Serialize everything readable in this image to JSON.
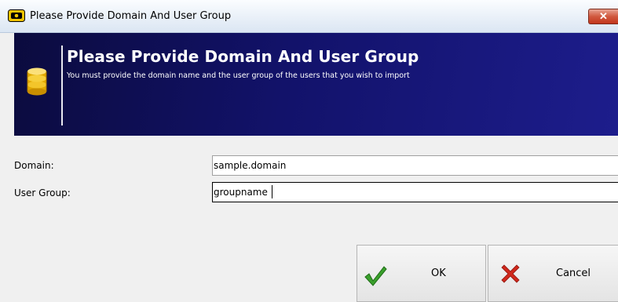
{
  "window": {
    "title": "Please Provide Domain And User Group",
    "close_glyph": "✕"
  },
  "banner": {
    "title": "Please Provide Domain And User Group",
    "subtitle": "You must provide the domain name and the user group of the users that you wish to import",
    "icon": "database-icon",
    "background_color": "#12126a"
  },
  "form": {
    "domain_label": "Domain:",
    "domain_value": "sample.domain",
    "group_label": "User Group:",
    "group_value": "groupname"
  },
  "buttons": {
    "ok_label": "OK",
    "ok_icon": "check-icon",
    "cancel_label": "Cancel",
    "cancel_icon": "x-icon"
  },
  "colors": {
    "check": "#3aa02c",
    "cancel": "#d0281c",
    "database": "#f0c020"
  }
}
